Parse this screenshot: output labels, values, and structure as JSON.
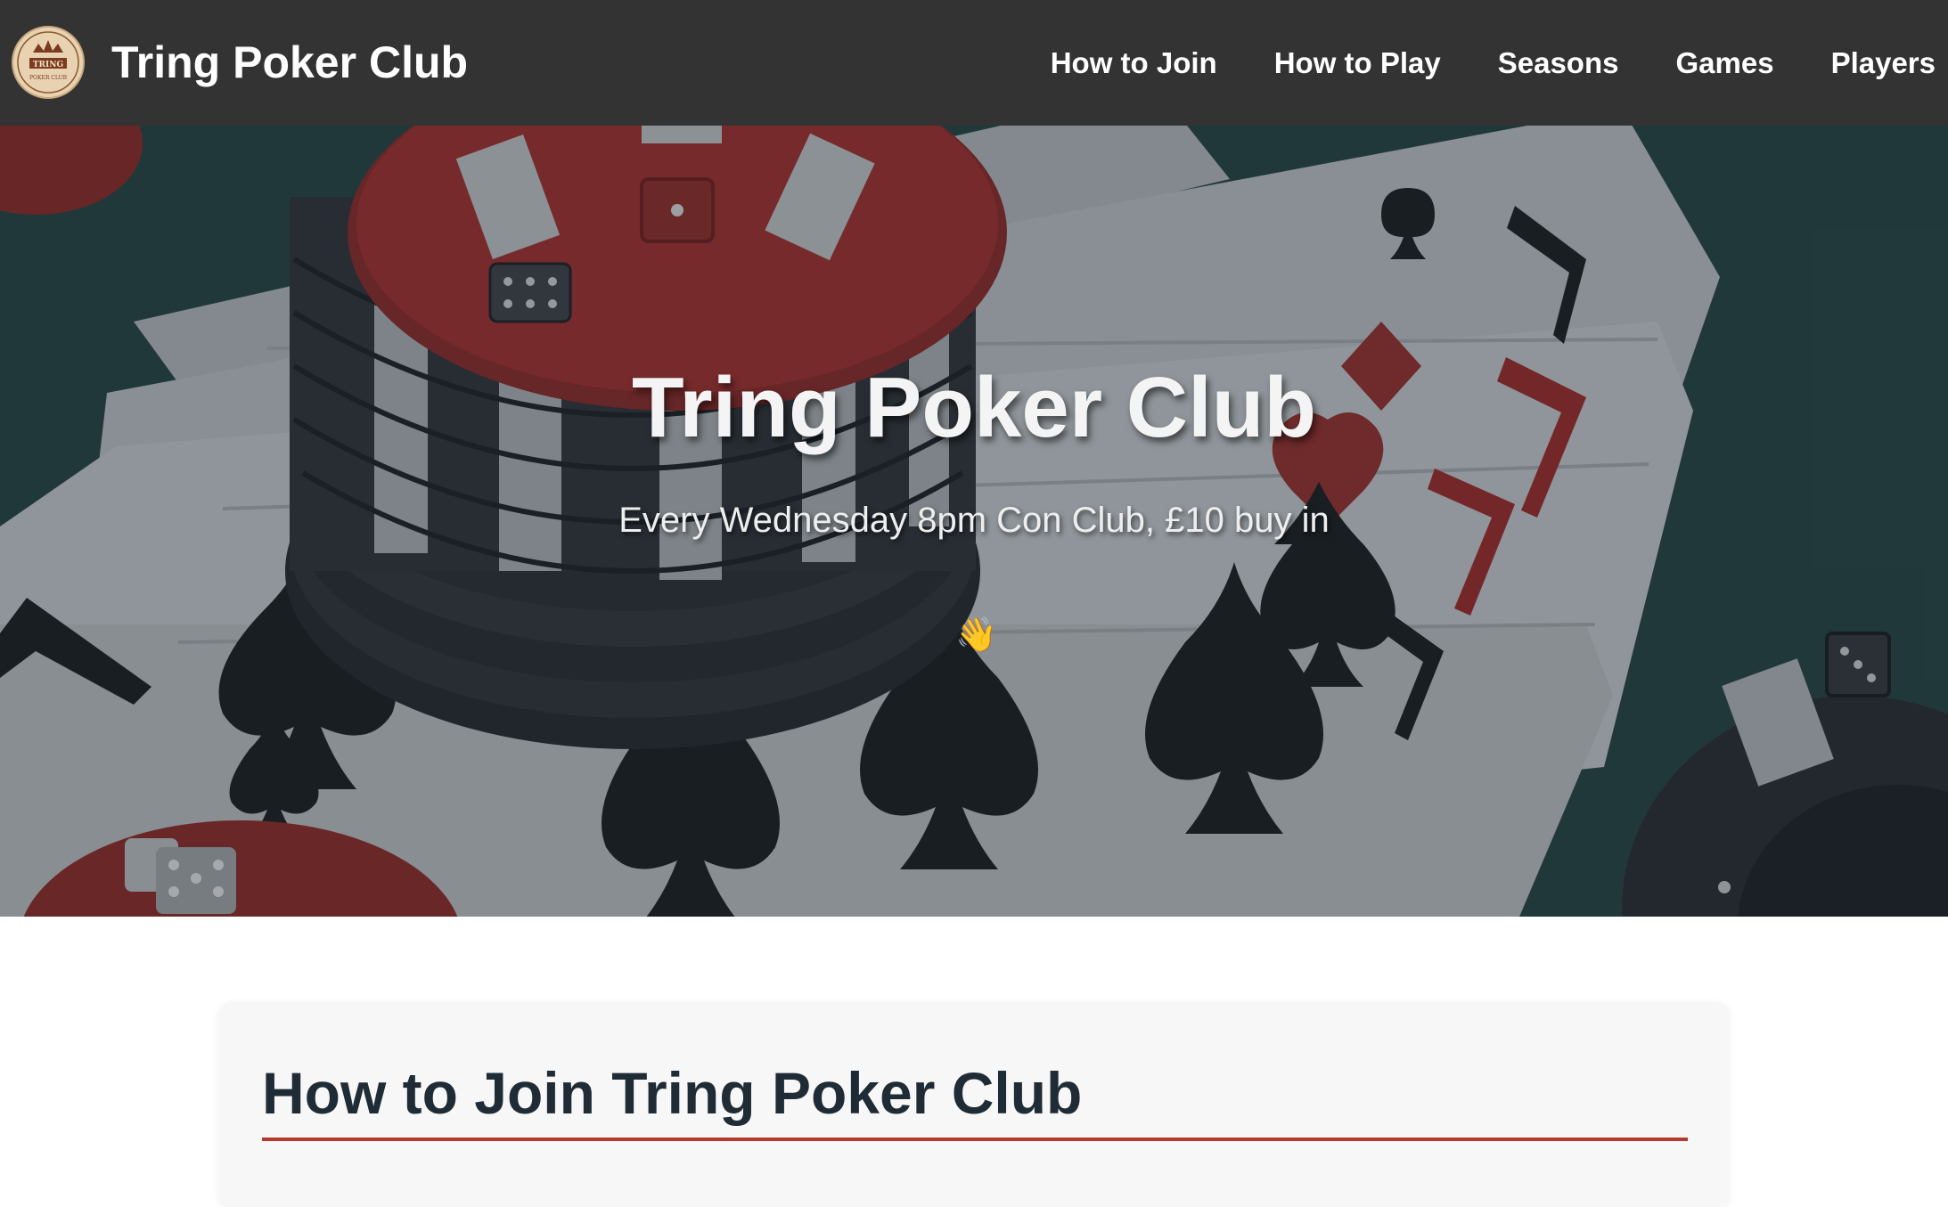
{
  "brand": {
    "title": "Tring Poker Club",
    "logo_text_top": "TRING",
    "logo_text_bottom": "POKER CLUB"
  },
  "nav": {
    "items": [
      {
        "label": "How to Join"
      },
      {
        "label": "How to Play"
      },
      {
        "label": "Seasons"
      },
      {
        "label": "Games"
      },
      {
        "label": "Players"
      }
    ]
  },
  "hero": {
    "title": "Tring Poker Club",
    "subtitle": "Every Wednesday 8pm Con Club, £10 buy in",
    "emoji": "👋"
  },
  "section": {
    "title": "How to Join Tring Poker Club"
  },
  "colors": {
    "navbar": "#333333",
    "accent_rule": "#b23a2e",
    "heading": "#1f2b35",
    "felt": "#2a4a47"
  }
}
